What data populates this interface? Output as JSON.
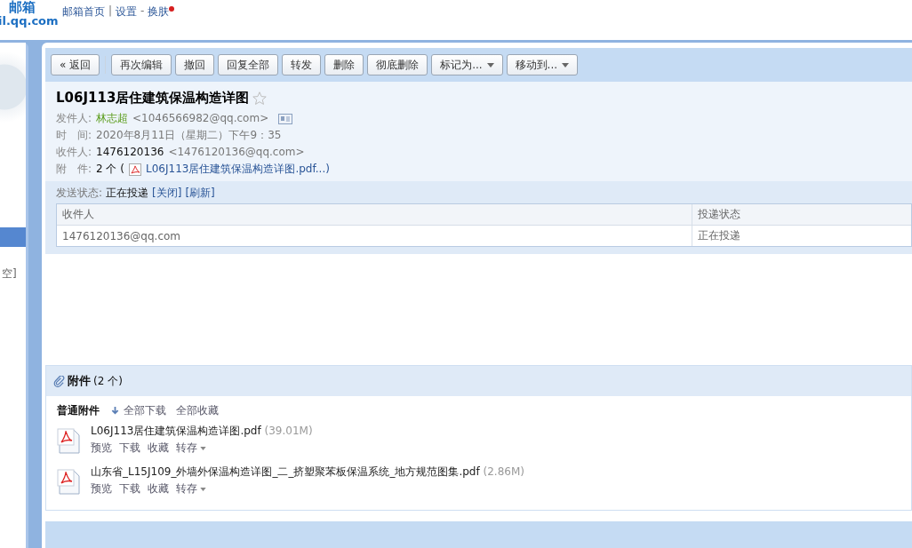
{
  "header": {
    "logo_title": "邮箱",
    "logo_domain": "il.qq.com",
    "links": [
      {
        "label": "邮箱首页"
      },
      {
        "label": "设置",
        "separator": "|"
      },
      {
        "label": "换肤",
        "separator": "-",
        "new_dot": true
      }
    ]
  },
  "sidebar": {
    "items": [
      {
        "selected": true
      }
    ],
    "clear_link": "空]"
  },
  "toolbar": {
    "buttons": [
      {
        "label": "« 返回",
        "dropdown": false
      },
      {
        "label": "再次编辑",
        "dropdown": false
      },
      {
        "label": "撤回",
        "dropdown": false
      },
      {
        "label": "回复全部",
        "dropdown": false
      },
      {
        "label": "转发",
        "dropdown": false
      },
      {
        "label": "删除",
        "dropdown": false
      },
      {
        "label": "彻底删除",
        "dropdown": false
      },
      {
        "label": "标记为...",
        "dropdown": true
      },
      {
        "label": "移动到...",
        "dropdown": true
      }
    ]
  },
  "mail": {
    "subject": "L06J113居住建筑保温构造详图",
    "starred": false,
    "fields": [
      {
        "label": "发件人:",
        "name": "林志超",
        "value": "<1046566982@qq.com>",
        "kind": "sender"
      },
      {
        "label": "时　间:",
        "value": "2020年8月11日（星期二）下午9：35",
        "kind": "plain"
      },
      {
        "label": "收件人:",
        "name": "1476120136",
        "value": "<1476120136@qq.com>",
        "kind": "recipient"
      },
      {
        "label": "附　件:",
        "name": "2 个 (",
        "value": "L06J113居住建筑保温构造详图.pdf...)",
        "kind": "attachment"
      }
    ]
  },
  "send_status": {
    "label": "发送状态:",
    "status": "正在投递",
    "links": [
      "[关闭]",
      "[刷新]"
    ],
    "table": {
      "columns": [
        "收件人",
        "投递状态"
      ],
      "rows": [
        [
          "1476120136@qq.com",
          "正在投递"
        ]
      ]
    }
  },
  "attachments": {
    "title": "附件",
    "count": "(2 个)",
    "group": "普通附件",
    "actions": [
      "全部下载",
      "全部收藏"
    ],
    "files": [
      {
        "name": "L06J113居住建筑保温构造详图.pdf",
        "size": "(39.01M)",
        "actions": [
          "预览",
          "下载",
          "收藏"
        ],
        "more": "转存"
      },
      {
        "name": "山东省_L15J109_外墙外保温构造详图_二_挤塑聚苯板保温系统_地方规范图集.pdf",
        "size": "(2.86M)",
        "actions": [
          "预览",
          "下载",
          "收藏"
        ],
        "more": "转存"
      }
    ]
  }
}
